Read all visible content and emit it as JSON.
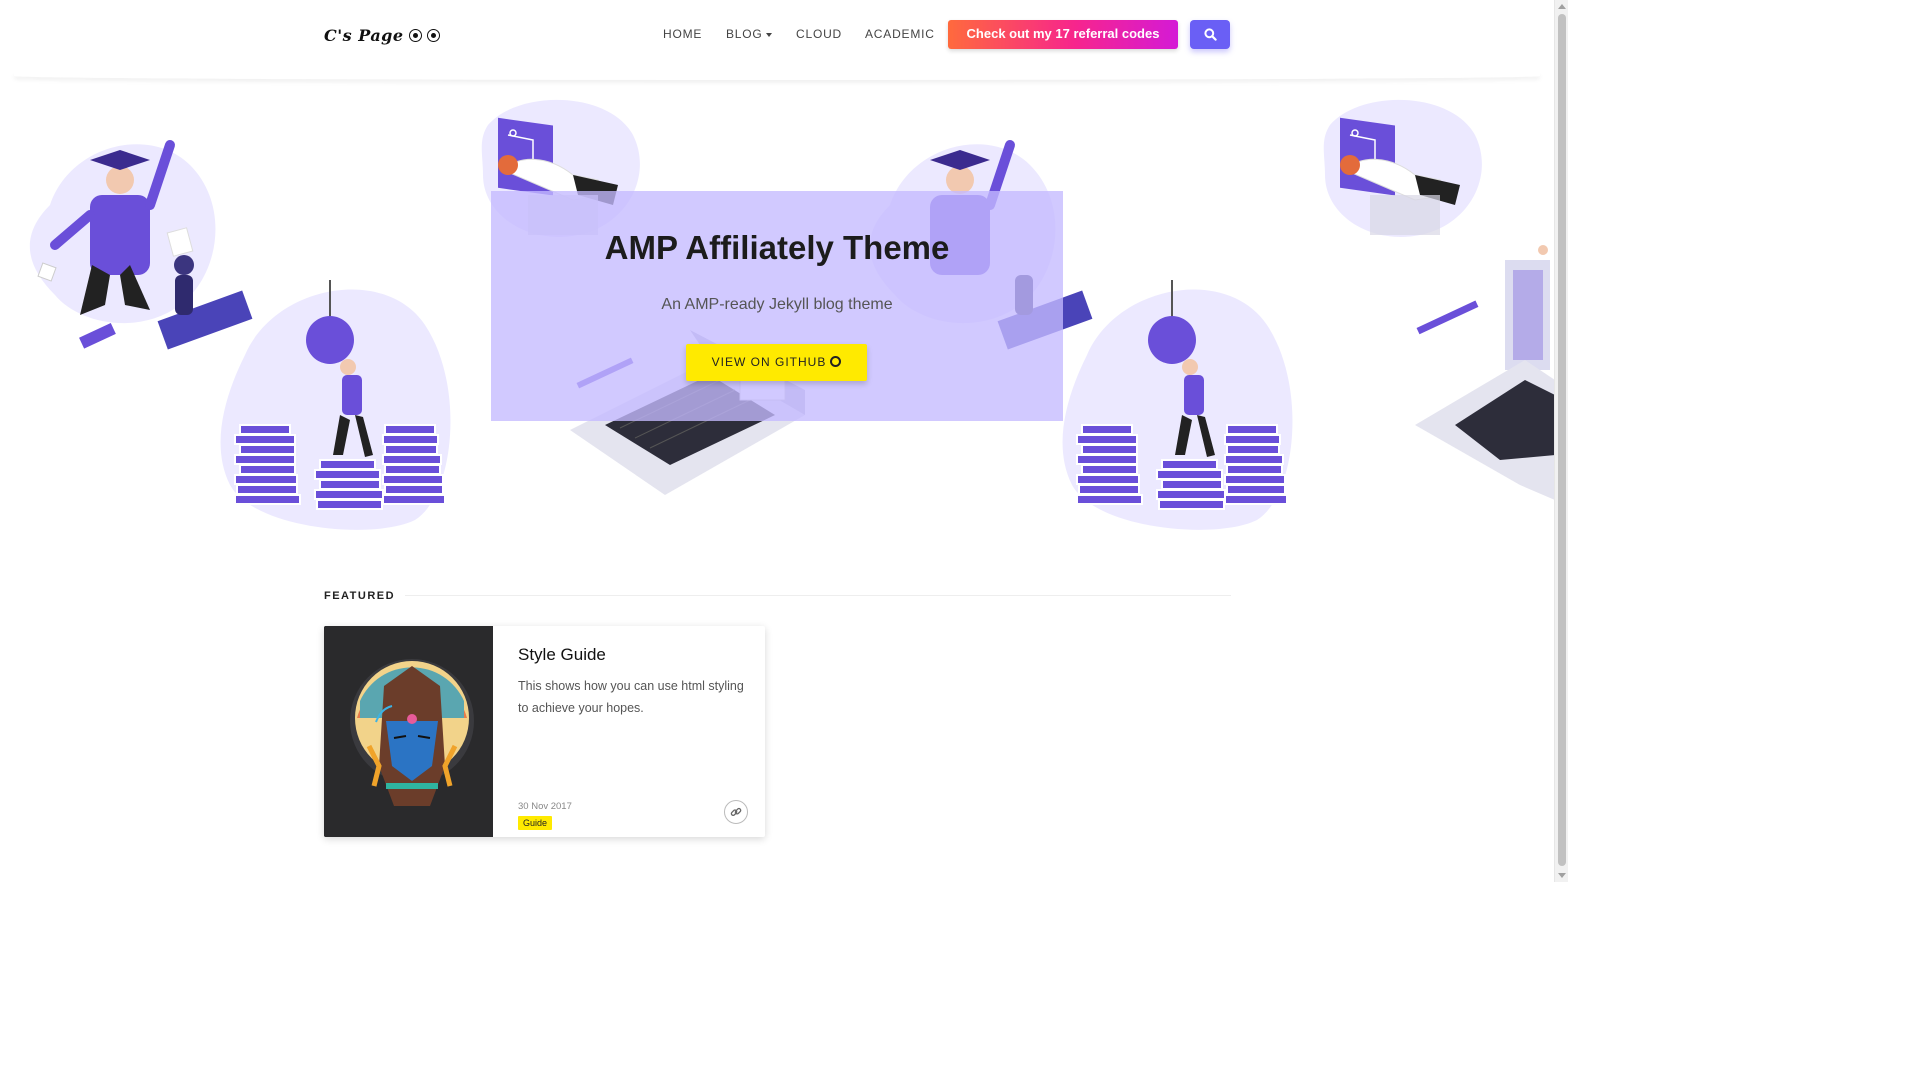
{
  "header": {
    "logo_text": "C's Page",
    "nav": [
      {
        "label": "HOME"
      },
      {
        "label": "BLOG"
      },
      {
        "label": "CLOUD"
      },
      {
        "label": "ACADEMIC"
      }
    ],
    "referral_button": "Check out my 17 referral codes",
    "search_icon": "search-icon"
  },
  "hero": {
    "title": "AMP Affiliately Theme",
    "subtitle": "An AMP-ready Jekyll blog theme",
    "cta_label": "VIEW ON GITHUB",
    "cta_icon": "github-icon"
  },
  "featured": {
    "label": "FEATURED",
    "post": {
      "title": "Style Guide",
      "description": "This shows how you can use html styling to achieve your hopes.",
      "date": "30 Nov 2017",
      "tag": "Guide",
      "link_icon": "link-icon"
    }
  },
  "colors": {
    "accent": "#6a5ff5",
    "hero_overlay": "#c4baff",
    "cta_yellow": "#ffea00",
    "referral_gradient": [
      "#ff6a3d",
      "#f7258c",
      "#d41ad6"
    ]
  }
}
